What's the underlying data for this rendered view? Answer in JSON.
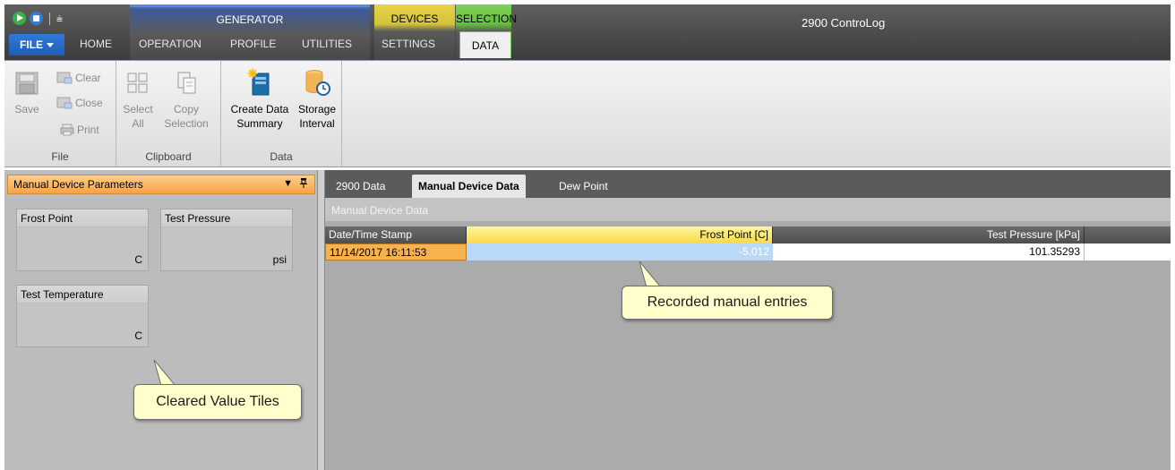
{
  "app": {
    "title": "2900 ControLog"
  },
  "qat": {
    "customize_glyph": "⩧"
  },
  "contexts": {
    "generator": "GENERATOR",
    "devices": "DEVICES",
    "selection": "SELECTION"
  },
  "tabs": {
    "file": "FILE",
    "home": "HOME",
    "operation": "OPERATION",
    "profile": "PROFILE",
    "utilities": "UTILITIES",
    "settings": "SETTINGS",
    "data": "DATA"
  },
  "ribbon": {
    "file_group": {
      "label": "File",
      "save": "Save",
      "clear": "Clear",
      "close": "Close",
      "print": "Print"
    },
    "clipboard_group": {
      "label": "Clipboard",
      "select_all_1": "Select",
      "select_all_2": "All",
      "copy_1": "Copy",
      "copy_2": "Selection"
    },
    "data_group": {
      "label": "Data",
      "summary_1": "Create Data",
      "summary_2": "Summary",
      "interval_1": "Storage",
      "interval_2": "Interval"
    }
  },
  "left_panel": {
    "title": "Manual Device Parameters",
    "tiles": [
      {
        "name": "Frost Point",
        "unit": "C"
      },
      {
        "name": "Test Pressure",
        "unit": "psi"
      },
      {
        "name": "Test Temperature",
        "unit": "C"
      }
    ]
  },
  "doc_tabs": [
    "2900 Data",
    "Manual Device Data",
    "Dew Point"
  ],
  "data_view": {
    "title": "Manual Device Data",
    "columns": [
      "Date/Time Stamp",
      "Frost Point [C]",
      "Test Pressure [kPa]"
    ],
    "rows": [
      [
        "11/14/2017 16:11:53",
        "-5.012",
        "101.35293"
      ]
    ]
  },
  "callouts": {
    "recorded": "Recorded manual entries",
    "cleared": "Cleared Value Tiles"
  },
  "colors": {
    "accent_selection": "#64c03d",
    "accent_devices": "#d4c23b",
    "panel_header": "#f7a24a",
    "selected_row": "#f7b24d"
  }
}
